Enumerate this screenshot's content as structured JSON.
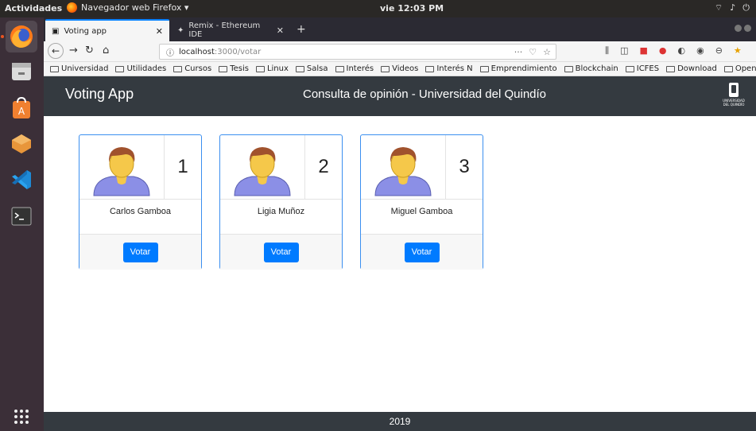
{
  "os": {
    "activities_label": "Actividades",
    "app_menu_label": "Navegador web Firefox ▾",
    "clock": "vie 12:03 PM"
  },
  "browser": {
    "tabs": [
      {
        "label": "Voting app",
        "active": true
      },
      {
        "label": "Remix - Ethereum IDE",
        "active": false
      }
    ],
    "url_host": "localhost",
    "url_path": ":3000/votar",
    "bookmarks": [
      "Universidad",
      "Utilidades",
      "Cursos",
      "Tesis",
      "Linux",
      "Salsa",
      "Interés",
      "Videos",
      "Interés N",
      "Emprendimiento",
      "Blockchain",
      "ICFES",
      "Download",
      "Open"
    ]
  },
  "app": {
    "title": "Voting App",
    "subtitle": "Consulta de opinión - Universidad del Quindío",
    "logo_text": "UNIVERSIDAD DEL QUINDÍO",
    "vote_button_label": "Votar",
    "candidates": [
      {
        "number": "1",
        "name": "Carlos Gamboa"
      },
      {
        "number": "2",
        "name": "Ligia Muñoz"
      },
      {
        "number": "3",
        "name": "Miguel Gamboa"
      }
    ],
    "footer_text": "2019"
  },
  "colors": {
    "header_bg": "#343a40",
    "card_border": "#3b8ff0",
    "button_bg": "#007bff",
    "avatar_skin": "#f5c84a",
    "avatar_hair": "#a0522d",
    "avatar_body": "#8b8fe6"
  }
}
